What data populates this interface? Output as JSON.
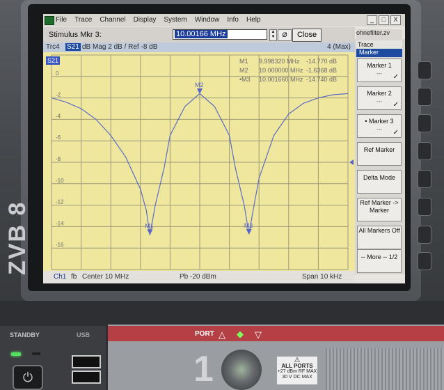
{
  "device": {
    "logo": "ZVB 8"
  },
  "menubar": {
    "items": [
      "File",
      "Trace",
      "Channel",
      "Display",
      "System",
      "Window",
      "Info",
      "Help"
    ],
    "window_buttons": [
      "_",
      "□",
      "X"
    ]
  },
  "stimulus": {
    "label": "Stimulus Mkr 3:",
    "value": "10.00166 MHz",
    "unit_button": "Ø",
    "close_label": "Close"
  },
  "trace": {
    "name": "Trc4",
    "param": "S21",
    "format": "dB Mag  2 dB /  Ref -8 dB",
    "right_label": "4 (Max)"
  },
  "plot": {
    "trace_label": "S21",
    "markers": [
      {
        "name": "M1",
        "freq": "9.998320 MHz",
        "value": "-14.770 dB"
      },
      {
        "name": "M2",
        "freq": "10.000000 MHz",
        "value": "-1.6368 dB"
      },
      {
        "name": "•M3",
        "freq": "10.001660 MHz",
        "value": "-14.740 dB"
      }
    ],
    "marker_tags": [
      "M1",
      "M2",
      "M3"
    ]
  },
  "chart_data": {
    "type": "line",
    "title": "",
    "xlabel": "",
    "ylabel": "",
    "x_range_khz": [
      -5,
      5
    ],
    "ylim": [
      -18,
      2
    ],
    "y_ticks": [
      0,
      -2,
      -4,
      -6,
      -8,
      -10,
      -12,
      -14,
      -16
    ],
    "y_tick_labels": [
      "0",
      "-2",
      "-4",
      "-6",
      "-8",
      "-10",
      "-12",
      "-14",
      "-16"
    ],
    "reference_level_db": -8,
    "series": [
      {
        "x_khz": [
          -5,
          -4.5,
          -4,
          -3.5,
          -3,
          -2.5,
          -2,
          -1.8,
          -1.68,
          -1.5,
          -1.2,
          -1,
          -0.5,
          0,
          0.5,
          1,
          1.2,
          1.5,
          1.66,
          1.8,
          2,
          2.5,
          3,
          3.5,
          4,
          4.5,
          5
        ],
        "y_db": [
          -2.0,
          -2.4,
          -3.0,
          -4.0,
          -5.5,
          -7.5,
          -10.5,
          -12.5,
          -14.8,
          -12.0,
          -8.5,
          -5.5,
          -2.8,
          -1.6,
          -2.8,
          -5.5,
          -8.5,
          -12.0,
          -14.7,
          -12.5,
          -9.5,
          -5.5,
          -3.5,
          -2.5,
          -2.0,
          -1.7,
          -1.6
        ]
      }
    ],
    "grid": true
  },
  "status": {
    "channel": "Ch1",
    "sweep": "fb",
    "center": "Center  10 MHz",
    "power": "Pb  -20 dBm",
    "span": "Span  10 kHz"
  },
  "softkeys": {
    "filename": "ohnefilter.zv",
    "menu_title": "Trace",
    "menu_sub": "Marker",
    "items": [
      {
        "label": "Marker 1",
        "sub": "---",
        "check": "✓"
      },
      {
        "label": "Marker 2",
        "sub": "---",
        "check": "✓"
      },
      {
        "label": "• Marker 3",
        "sub": "---",
        "check": "✓"
      },
      {
        "label": "Ref Marker",
        "sub": "",
        "check": ""
      },
      {
        "label": "Delta Mode",
        "sub": "",
        "check": ""
      },
      {
        "label": "Ref Marker -> Marker",
        "sub": "",
        "check": ""
      },
      {
        "label": "All Markers Off",
        "sub": "",
        "check": ""
      },
      {
        "label": "-- More -- 1/2",
        "sub": "",
        "check": ""
      }
    ]
  },
  "panel": {
    "standby_label": "STANDBY",
    "usb_label": "USB",
    "port_label": "PORT",
    "port_number": "1",
    "allports_title": "ALL PORTS",
    "allports_line1": "+27 dBm RF MAX",
    "allports_line2": "30 V DC MAX"
  }
}
